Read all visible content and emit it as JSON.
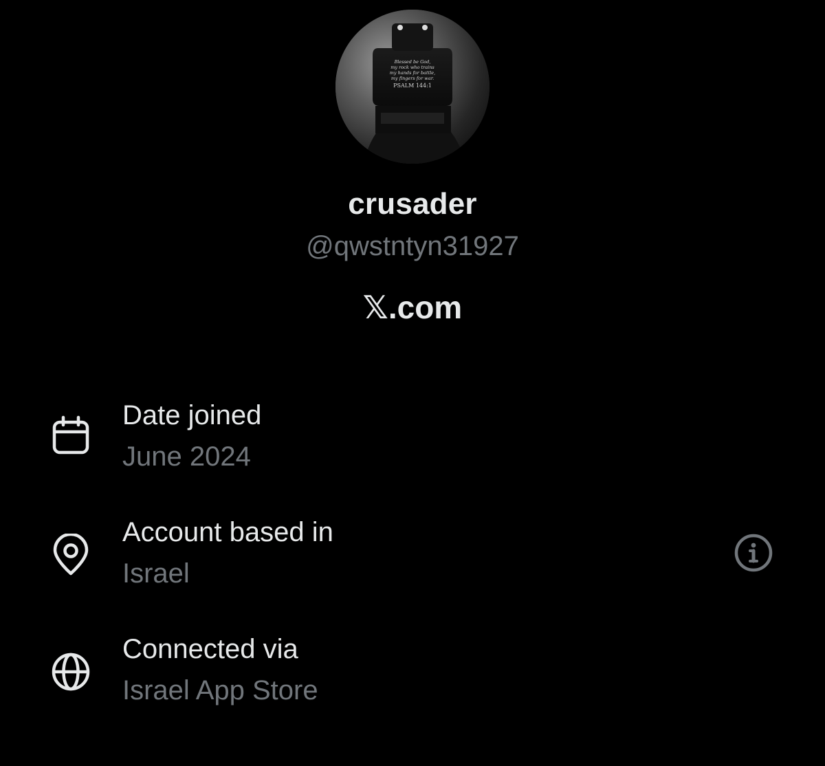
{
  "profile": {
    "display_name": "crusader",
    "handle": "@qwstntyn31927",
    "source_prefix": "𝕏",
    "source_suffix": ".com",
    "avatar": {
      "icon": "avatar-photo",
      "inscription": [
        "Blessed be God,",
        "my rock who trains",
        "my hands for battle,",
        "my fingers for war.",
        "PSALM 144:1"
      ]
    }
  },
  "details": [
    {
      "icon": "calendar-icon",
      "title": "Date joined",
      "value": "June 2024"
    },
    {
      "icon": "location-pin-icon",
      "title": "Account based in",
      "value": "Israel",
      "trailing_icon": "info-icon"
    },
    {
      "icon": "globe-icon",
      "title": "Connected via",
      "value": "Israel App Store"
    }
  ],
  "colors": {
    "background": "#000000",
    "primary_text": "#e7e9ea",
    "secondary_text": "#71767b",
    "icon": "#e7e9ea",
    "info_icon": "#71767b"
  }
}
